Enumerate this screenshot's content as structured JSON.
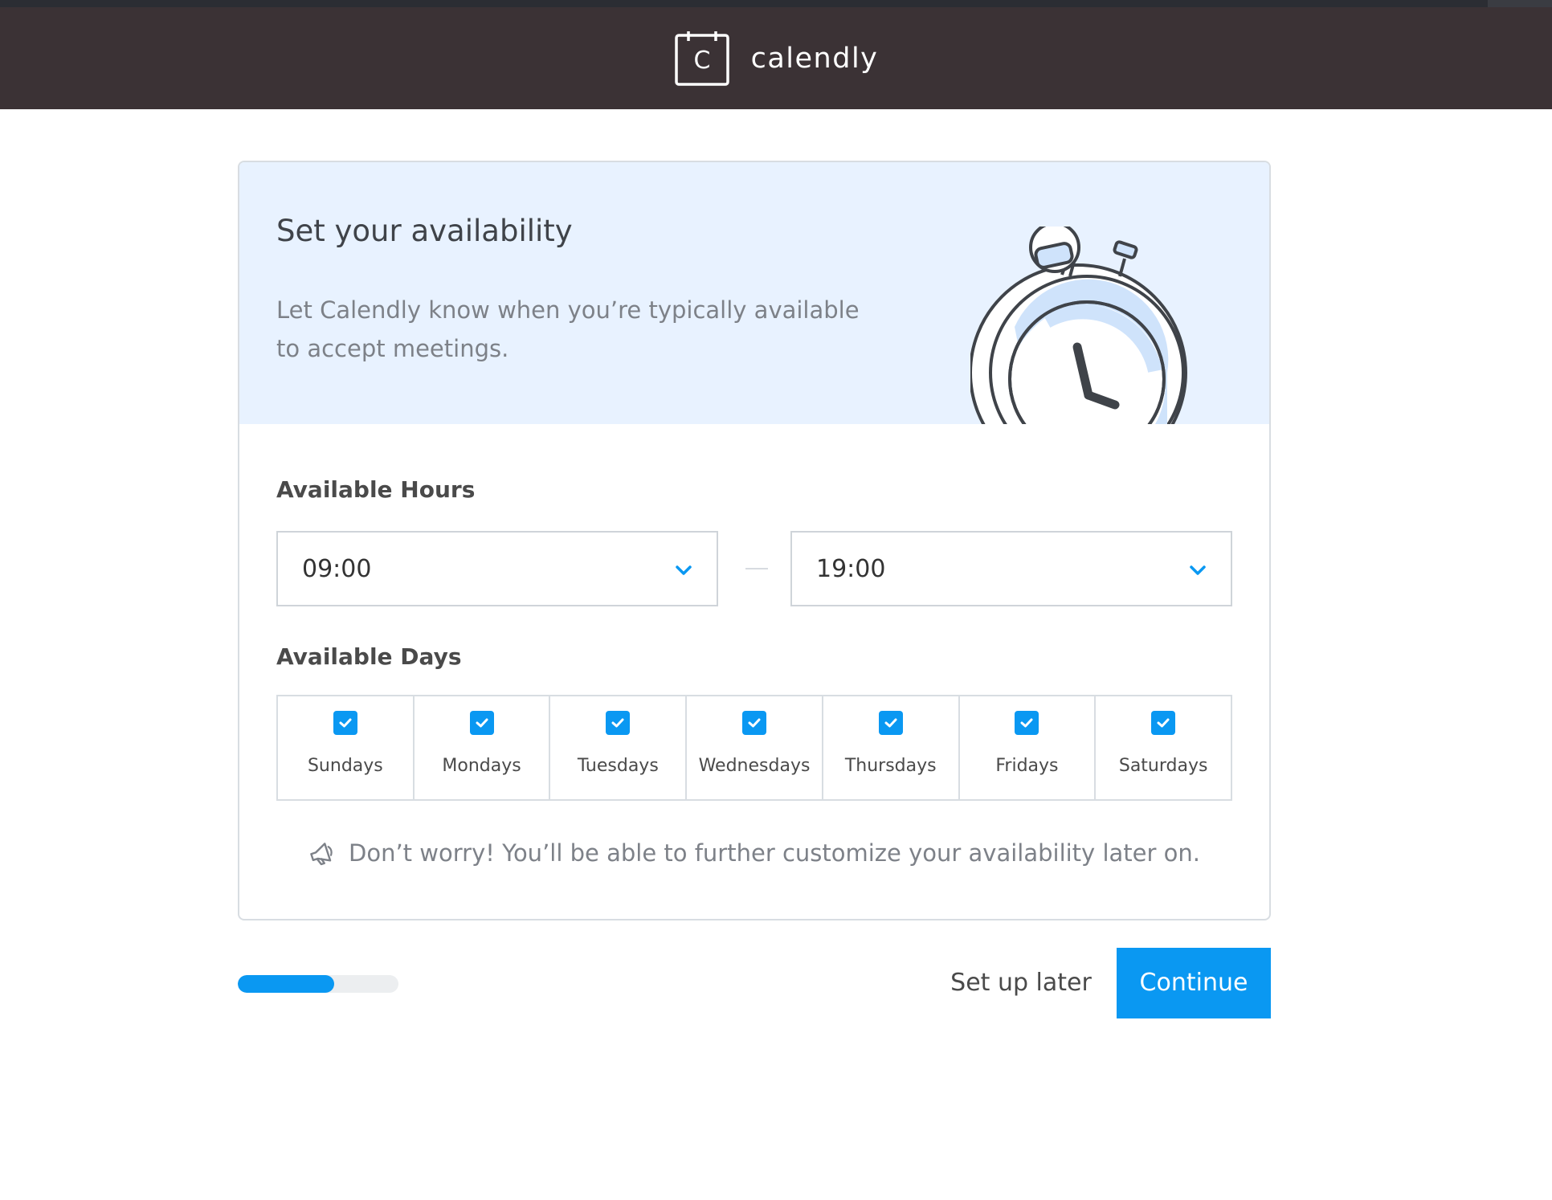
{
  "header": {
    "logo_letter": "C",
    "brand_name": "calendly"
  },
  "hero": {
    "title": "Set your availability",
    "description": "Let Calendly know when you’re typically available to accept meetings."
  },
  "hours": {
    "label": "Available Hours",
    "start_value": "09:00",
    "end_value": "19:00"
  },
  "days": {
    "label": "Available Days",
    "items": [
      {
        "label": "Sundays",
        "checked": true
      },
      {
        "label": "Mondays",
        "checked": true
      },
      {
        "label": "Tuesdays",
        "checked": true
      },
      {
        "label": "Wednesdays",
        "checked": true
      },
      {
        "label": "Thursdays",
        "checked": true
      },
      {
        "label": "Fridays",
        "checked": true
      },
      {
        "label": "Saturdays",
        "checked": true
      }
    ]
  },
  "notice": {
    "text": "Don’t worry! You’ll be able to further customize your availability later on.",
    "icon": "megaphone-icon"
  },
  "footer": {
    "progress_percent": 60,
    "later_label": "Set up later",
    "continue_label": "Continue"
  },
  "colors": {
    "accent": "#0a98f2",
    "header_bg": "#3b3235",
    "hero_bg": "#e8f2ff"
  }
}
